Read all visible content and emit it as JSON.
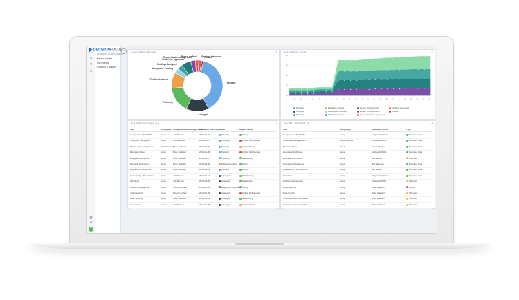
{
  "app": {
    "logo_brand": "DECISION",
    "logo_suffix": "FOCUS",
    "subtitle": "RISK AND COMPLIANCE",
    "nav": [
      "Recent activity",
      "My reviews",
      "Findings & Actions"
    ]
  },
  "colors": {
    "pending": "#4a90d9",
    "arranged": "#2f3a48",
    "planning": "#5cb85c",
    "fieldwork": "#f0a04b",
    "acceptance": "#5bc0de",
    "accepted": "#3aa0a0",
    "report_to_approve": "#1f7a7a",
    "approved": "#8e44ad",
    "report_drafted": "#e74c3c",
    "challenged": "#d9534f",
    "closed": "#c0392b"
  },
  "monitoring": {
    "title": "MONITORING REVIEW",
    "slices": [
      {
        "label": "Pending",
        "value": 38,
        "color": "#6aa8e6"
      },
      {
        "label": "Arranged",
        "value": 14,
        "color": "#333d49"
      },
      {
        "label": "Planning",
        "value": 16,
        "color": "#5cb85c"
      },
      {
        "label": "Fieldwork started",
        "value": 10,
        "color": "#f0a04b"
      },
      {
        "label": "Acceptance Pending",
        "value": 3,
        "color": "#8fd3e8"
      },
      {
        "label": "Findings Accepted",
        "value": 3,
        "color": "#3aa0a0"
      },
      {
        "label": "Report (Ur Approval)",
        "value": 6,
        "color": "#1f7a7a"
      },
      {
        "label": "Report Business Approved",
        "value": 3,
        "color": "#8e44ad"
      },
      {
        "label": "Report drafted",
        "value": 2,
        "color": "#e74c3c"
      },
      {
        "label": "Findings Delivered",
        "value": 2,
        "color": "#d9534f"
      },
      {
        "label": "Closed",
        "value": 1,
        "color": "#c0392b"
      }
    ]
  },
  "planned_by_year": {
    "title": "PLANNED BY YEAR",
    "legend": [
      {
        "label": "Pending",
        "color": "#6aa8e6"
      },
      {
        "label": "Arranged",
        "color": "#333d49"
      },
      {
        "label": "Planning",
        "color": "#5cb85c"
      },
      {
        "label": "Fieldwork started",
        "color": "#f0a04b"
      },
      {
        "label": "Acceptance Pending",
        "color": "#8fd3e8"
      },
      {
        "label": "Findings Accepted",
        "color": "#3aa0a0"
      },
      {
        "label": "Report (Ur Approval)",
        "color": "#1f7a7a"
      },
      {
        "label": "Report (Ur Approved)",
        "color": "#8e44ad"
      },
      {
        "label": "Report Business Approved",
        "color": "#e74c3c"
      },
      {
        "label": "Findings Delivered",
        "color": "#d9534f"
      },
      {
        "label": "Closed",
        "color": "#c0392b"
      }
    ]
  },
  "chart_data": {
    "type": "area",
    "x": [
      "J",
      "F",
      "M",
      "A",
      "M",
      "J",
      "J",
      "A",
      "S",
      "O",
      "N",
      "D",
      "J",
      "F",
      "M",
      "A",
      "M",
      "J",
      "J",
      "A",
      "S",
      "O",
      "N",
      "D"
    ],
    "ylim": [
      0,
      80
    ],
    "yticks": [
      "80",
      "60",
      "40",
      "20",
      "0"
    ],
    "series": [
      {
        "name": "Planning",
        "color": "#79d59a",
        "values": [
          14,
          14,
          14,
          14,
          15,
          16,
          16,
          16,
          70,
          70,
          70,
          70,
          71,
          72,
          73,
          74,
          75,
          75,
          76,
          77,
          77,
          78,
          78,
          78
        ]
      },
      {
        "name": "Findings Accepted",
        "color": "#3aa0a0",
        "values": [
          10,
          10,
          10,
          10,
          11,
          12,
          12,
          12,
          48,
          48,
          48,
          48,
          49,
          49,
          50,
          50,
          50,
          51,
          51,
          51,
          52,
          52,
          52,
          52
        ]
      },
      {
        "name": "Report (Ur Approval)",
        "color": "#1f7a7a",
        "values": [
          6,
          6,
          6,
          6,
          7,
          8,
          8,
          8,
          30,
          30,
          30,
          30,
          30,
          31,
          31,
          31,
          31,
          32,
          32,
          32,
          32,
          33,
          33,
          33
        ]
      },
      {
        "name": "Report (Ur Approved)",
        "color": "#8e44ad",
        "values": [
          3,
          3,
          3,
          3,
          4,
          5,
          5,
          5,
          12,
          12,
          12,
          12,
          12,
          12,
          13,
          13,
          13,
          13,
          13,
          13,
          14,
          14,
          14,
          14
        ]
      }
    ]
  },
  "planned_reviews": {
    "title": "PLANNED REVIEWS (10)",
    "columns": [
      "Title",
      "Geography",
      "Compliance Monitoring Officer",
      "Fieldwork Start Date",
      "Status",
      "Report Rating"
    ],
    "rows": [
      {
        "title": "Compliance with GDPR",
        "geo": "Group",
        "officer": "Jeff Beckett",
        "date": "2018-10-01",
        "status": "Pending",
        "status_color": "#6aa8e6",
        "rating": "Strong",
        "rating_color": "#5cb85c"
      },
      {
        "title": "Customer Complaints",
        "geo": "Group",
        "officer": "Jeff Matthews",
        "date": "2018-04-17",
        "status": "Planning",
        "status_color": "#5cb85c",
        "rating": "Critical Deficiencies",
        "rating_color": "#e74c3c"
      },
      {
        "title": "Third party management",
        "geo": "Global Europe",
        "officer": "Brian Hadeleri",
        "date": "2018-01-01",
        "status": "Pending",
        "status_color": "#6aa8e6",
        "rating": "Unsatisfactory",
        "rating_color": "#f0a04b"
      },
      {
        "title": "Financial Crime",
        "geo": "Group",
        "officer": "Brian Hadeleri",
        "date": "2018-01-06",
        "status": "Pending",
        "status_color": "#6aa8e6",
        "rating": "Critical Deficiencies",
        "rating_color": "#e74c3c"
      },
      {
        "title": "Delegated Authorities",
        "geo": "Group",
        "officer": "Brian Hadeleri",
        "date": "2018-01-17",
        "status": "Pending",
        "status_color": "#6aa8e6",
        "rating": "Satisfactory",
        "rating_color": "#5cb85c"
      },
      {
        "title": "Financial Promotions",
        "geo": "Group",
        "officer": "Brian Hadeleri",
        "date": "2018-09-03",
        "status": "Fieldwork started",
        "status_color": "#f0a04b",
        "rating": "Strong",
        "rating_color": "#5cb85c"
      },
      {
        "title": "Operational Resilience",
        "geo": "Group",
        "officer": "Brian Hadeleri",
        "date": "2018-09-03",
        "status": "Pending",
        "status_color": "#6aa8e6",
        "rating": "Strong",
        "rating_color": "#5cb85c"
      },
      {
        "title": "Outsourcing - Firm data w...",
        "geo": "Group",
        "officer": "Jeff Beckett",
        "date": "2018-09-14",
        "status": "Arranged",
        "status_color": "#333d49",
        "rating": "Satisfactory",
        "rating_color": "#5cb85c"
      },
      {
        "title": "Sanctions",
        "geo": "Group",
        "officer": "Jeff Beckett",
        "date": "2018-09-03",
        "status": "Arranged",
        "status_color": "#333d49",
        "rating": "Satisfactory",
        "rating_color": "#5cb85c"
      },
      {
        "title": "Product Development",
        "geo": "Group",
        "officer": "Simon Hughes",
        "date": "2018-01-06",
        "status": "Report (Ur Approved)",
        "status_color": "#8e44ad",
        "rating": "Strong",
        "rating_color": "#5cb85c"
      },
      {
        "title": "Cyber security",
        "geo": "Group",
        "officer": "Simon Hughes",
        "date": "2018-06-03",
        "status": "Arranged",
        "status_color": "#333d49",
        "rating": "Critical Deficiencies",
        "rating_color": "#e74c3c"
      },
      {
        "title": "Data Security",
        "geo": "Group",
        "officer": "Brian Hadeleri",
        "date": "2018-01-06",
        "status": "Arranged",
        "status_color": "#333d49",
        "rating": "Satisfactory",
        "rating_color": "#5cb85c"
      },
      {
        "title": "Governance",
        "geo": "Group",
        "officer": "Jeff Beckett",
        "date": "2018-01-06",
        "status": "Arranged",
        "status_color": "#333d49",
        "rating": "Unsatisfactory",
        "rating_color": "#f0a04b"
      }
    ]
  },
  "key_reviews": {
    "title": "KEY RAT REVIEWS (9)",
    "columns": [
      "Title",
      "Geography",
      "Executive Officer",
      "Type"
    ],
    "rows": [
      {
        "title": "Compliance with GDPR",
        "geo": "Group",
        "officer": "Magnus England",
        "type": "Business Area"
      },
      {
        "title": "Third party management",
        "geo": "Global Europe",
        "officer": "Andrew Griffiths",
        "type": "Business Area"
      },
      {
        "title": "Financial Crime",
        "geo": "Group",
        "officer": "Simon Hughes",
        "type": "Business Area"
      },
      {
        "title": "Delegated Authorities",
        "geo": "Group",
        "officer": "Andrew Griffiths",
        "type": "Business Area"
      },
      {
        "title": "Financial Promotions",
        "geo": "Group",
        "officer": "Jeff Hibbert",
        "type": "Thematic"
      },
      {
        "title": "Operational Resilience",
        "geo": "Group",
        "officer": "Jeff Bateman",
        "type": "Business Area"
      },
      {
        "title": "Outsourcing - Firm data w...",
        "geo": "Group",
        "officer": "Jeff Hibbert",
        "type": "Business Area"
      },
      {
        "title": "Sanctions",
        "geo": "Group",
        "officer": "Magnus England",
        "type": "Business Area"
      },
      {
        "title": "Product Development",
        "geo": "Group",
        "officer": "Andrew Griffiths",
        "type": "Thematic"
      },
      {
        "title": "Cyber security",
        "geo": "Group",
        "officer": "Brian Hadeleri",
        "type": "Ad hoc"
      },
      {
        "title": "Data Security",
        "geo": "Group",
        "officer": "Brian Hadeleri",
        "type": "Thematic"
      },
      {
        "title": "Unverified Risk Permission",
        "geo": "Group",
        "officer": "Brian Hadeleri",
        "type": "Thematic"
      },
      {
        "title": "Internal Environmental Ex",
        "geo": "Group",
        "officer": "Brian Hadeleri",
        "type": "Thematic"
      }
    ]
  }
}
